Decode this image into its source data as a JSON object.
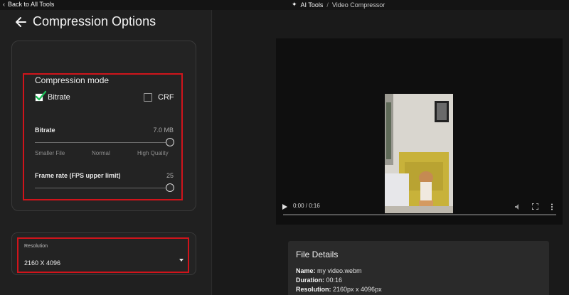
{
  "topbar": {
    "back_label": "Back to All Tools",
    "crumb_root": "AI Tools",
    "crumb_sep": "/",
    "crumb_current": "Video Compressor"
  },
  "page": {
    "title": "Compression Options"
  },
  "compression": {
    "mode_label": "Compression mode",
    "options": [
      {
        "label": "Bitrate",
        "checked": true
      },
      {
        "label": "CRF",
        "checked": false
      }
    ],
    "bitrate": {
      "label": "Bitrate",
      "value_text": "7.0 MB",
      "level": 1.0,
      "scale": [
        "Smaller File",
        "Normal",
        "High Quality"
      ]
    },
    "framerate": {
      "label": "Frame rate (FPS upper limit)",
      "value_text": "25",
      "level": 1.0
    }
  },
  "resolution": {
    "label": "Resolution",
    "value": "2160 X 4096"
  },
  "player": {
    "time": "0:00 / 0:16",
    "progress": 0.0
  },
  "details": {
    "title": "File Details",
    "rows": [
      {
        "key": "Name:",
        "value": "my video.webm"
      },
      {
        "key": "Duration:",
        "value": "00:16"
      },
      {
        "key": "Resolution:",
        "value": "2160px x 4096px"
      }
    ]
  },
  "colors": {
    "accent_check": "#1fbf5a",
    "highlight_box": "#d0141b"
  }
}
